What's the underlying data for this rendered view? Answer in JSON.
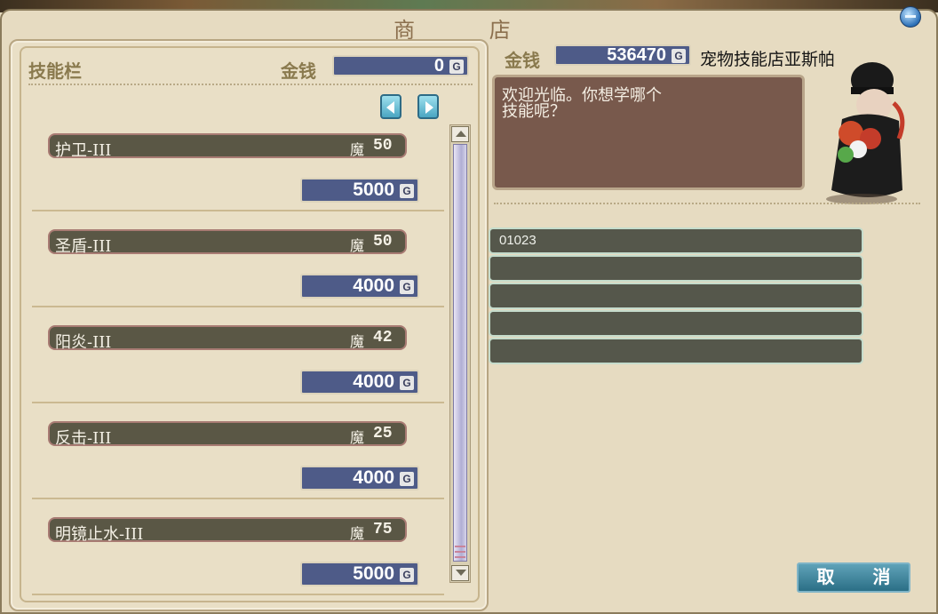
{
  "window": {
    "title": "商 店"
  },
  "left": {
    "header_label": "技能栏",
    "money_label": "金钱",
    "money_value": "0",
    "currency": "G"
  },
  "skills": [
    {
      "name": "护卫-III",
      "mp_label": "魔",
      "mp": "50",
      "price": "5000"
    },
    {
      "name": "圣盾-III",
      "mp_label": "魔",
      "mp": "50",
      "price": "4000"
    },
    {
      "name": "阳炎-III",
      "mp_label": "魔",
      "mp": "42",
      "price": "4000"
    },
    {
      "name": "反击-III",
      "mp_label": "魔",
      "mp": "25",
      "price": "4000"
    },
    {
      "name": "明镜止水-III",
      "mp_label": "魔",
      "mp": "75",
      "price": "5000"
    }
  ],
  "right": {
    "money_label": "金钱",
    "money_value": "536470",
    "currency": "G",
    "shopkeeper": "宠物技能店亚斯帕",
    "dialog": [
      "欢迎光临。你想学哪个",
      "技能呢？"
    ],
    "pet_slots": [
      "01023",
      "",
      "",
      "",
      ""
    ],
    "cancel_label": "取 消"
  }
}
